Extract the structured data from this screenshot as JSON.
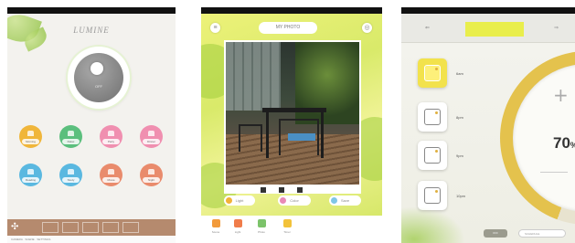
{
  "screen1": {
    "title": "LUMINE",
    "dial_text": "OFF",
    "scenes": [
      {
        "label": "Morning",
        "color": "#f0b63a"
      },
      {
        "label": "Relax",
        "color": "#5bbf7d"
      },
      {
        "label": "Party",
        "color": "#f08fb0"
      },
      {
        "label": "Dinner",
        "color": "#f08fb0"
      },
      {
        "label": "Reading",
        "color": "#5ab8e0"
      },
      {
        "label": "Study",
        "color": "#5ab8e0"
      },
      {
        "label": "Movie",
        "color": "#e98b6c"
      },
      {
        "label": "Night",
        "color": "#e98b6c"
      }
    ],
    "footer": "CAMERA · SCENE · SETTINGS"
  },
  "screen2": {
    "title": "MY PHOTO",
    "buttons": [
      {
        "label": "Light",
        "color": "#f2b238"
      },
      {
        "label": "Color",
        "color": "#e98ab6"
      },
      {
        "label": "Save",
        "color": "#7fc6e6"
      }
    ],
    "tabs": [
      {
        "label": "Scene",
        "color": "#f29a3a"
      },
      {
        "label": "Light",
        "color": "#f07c4a"
      },
      {
        "label": "Photo",
        "color": "#7cc36a"
      },
      {
        "label": "Timer",
        "color": "#f2c23a"
      }
    ]
  },
  "screen3": {
    "timers": [
      {
        "label": "6am"
      },
      {
        "label": "8pm"
      },
      {
        "label": "9pm"
      },
      {
        "label": "10pm"
      }
    ],
    "temp_value": "70",
    "temp_unit": "%",
    "plus": "+",
    "pill_a": "OFF",
    "pill_b": "SCHEDULE"
  }
}
